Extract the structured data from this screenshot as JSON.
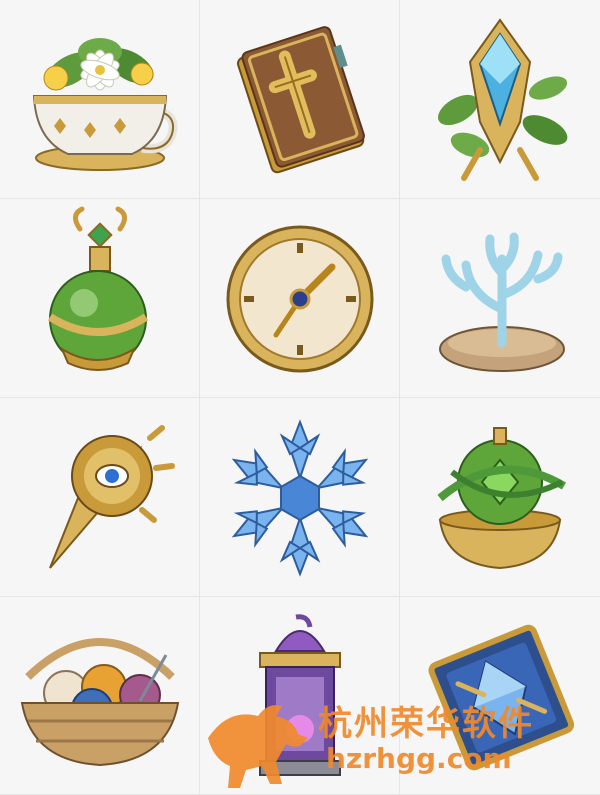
{
  "grid": {
    "items": [
      {
        "icon": "flower-teacup-icon"
      },
      {
        "icon": "cross-book-icon"
      },
      {
        "icon": "crystal-leaf-crest-icon"
      },
      {
        "icon": "green-orb-flask-icon"
      },
      {
        "icon": "golden-clock-icon"
      },
      {
        "icon": "ice-coral-icon"
      },
      {
        "icon": "eye-blade-pin-icon"
      },
      {
        "icon": "ice-snowflake-icon"
      },
      {
        "icon": "vine-gem-pot-icon"
      },
      {
        "icon": "yarn-basket-icon"
      },
      {
        "icon": "purple-lantern-icon"
      },
      {
        "icon": "crystal-chest-icon"
      }
    ]
  },
  "watermark": {
    "brand": "杭州荣华软件",
    "domain": "hzrhgg.com",
    "color": "#f08a2c"
  }
}
